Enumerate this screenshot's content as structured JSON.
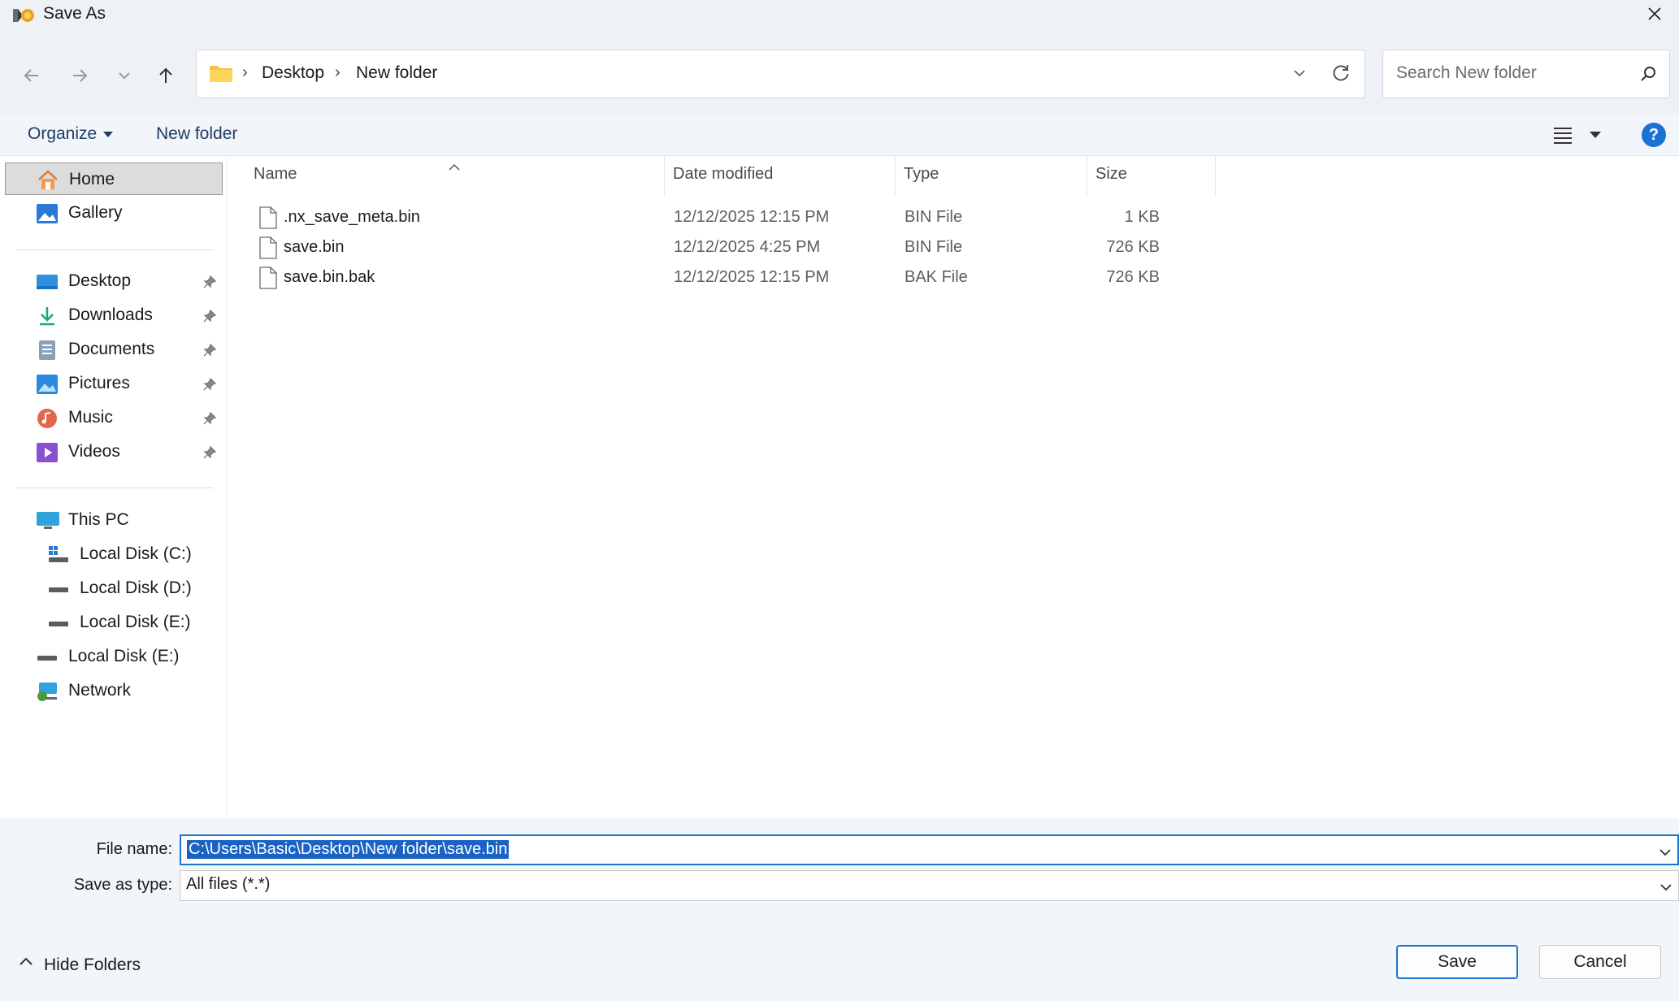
{
  "window": {
    "title": "Save As"
  },
  "address": {
    "crumbs": [
      "Desktop",
      "New folder"
    ],
    "separator": "›"
  },
  "search": {
    "placeholder": "Search New folder"
  },
  "toolbar": {
    "organize_label": "Organize",
    "new_folder_label": "New folder",
    "help_label": "?"
  },
  "sidebar": {
    "quick": [
      {
        "label": "Home",
        "icon": "home-icon",
        "selected": true
      },
      {
        "label": "Gallery",
        "icon": "gallery-icon"
      }
    ],
    "pinned": [
      {
        "label": "Desktop",
        "icon": "desktop-icon"
      },
      {
        "label": "Downloads",
        "icon": "downloads-icon"
      },
      {
        "label": "Documents",
        "icon": "documents-icon"
      },
      {
        "label": "Pictures",
        "icon": "pictures-icon"
      },
      {
        "label": "Music",
        "icon": "music-icon"
      },
      {
        "label": "Videos",
        "icon": "videos-icon"
      }
    ],
    "this_pc": {
      "label": "This PC",
      "icon": "this-pc-icon"
    },
    "drives": [
      {
        "label": "Local Disk (C:)",
        "icon": "system-drive-icon"
      },
      {
        "label": "Local Disk (D:)",
        "icon": "drive-icon"
      },
      {
        "label": "Local Disk (E:)",
        "icon": "drive-icon"
      }
    ],
    "extra_drive": {
      "label": "Local Disk (E:)",
      "icon": "drive-icon"
    },
    "network": {
      "label": "Network",
      "icon": "network-icon"
    }
  },
  "columns": {
    "name": "Name",
    "date": "Date modified",
    "type": "Type",
    "size": "Size"
  },
  "files": [
    {
      "name": ".nx_save_meta.bin",
      "date": "12/12/2025 12:15 PM",
      "type": "BIN File",
      "size": "1 KB"
    },
    {
      "name": "save.bin",
      "date": "12/12/2025 4:25 PM",
      "type": "BIN File",
      "size": "726 KB"
    },
    {
      "name": "save.bin.bak",
      "date": "12/12/2025 12:15 PM",
      "type": "BAK File",
      "size": "726 KB"
    }
  ],
  "fields": {
    "file_name_label": "File name:",
    "file_name_value": "C:\\Users\\Basic\\Desktop\\New folder\\save.bin",
    "save_type_label": "Save as type:",
    "save_type_value": "All files (*.*)"
  },
  "footer": {
    "hide_folders_label": "Hide Folders",
    "save_label": "Save",
    "cancel_label": "Cancel"
  },
  "colors": {
    "accent": "#1a73d2",
    "chrome": "#eef1f6",
    "selection": "#1a63c4"
  }
}
